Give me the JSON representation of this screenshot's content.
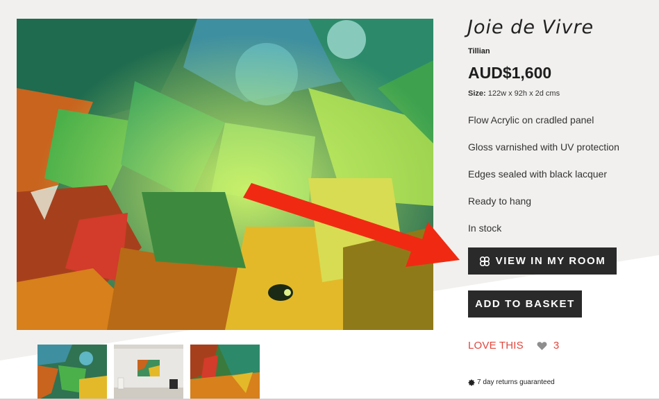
{
  "product": {
    "title": "Joie de Vivre",
    "artist": "Tillian",
    "price": "AUD$1,600",
    "size_label": "Size:",
    "size_value": "122w x 92h x 2d cms",
    "features": [
      "Flow Acrylic on cradled panel",
      "Gloss varnished with UV protection",
      "Edges sealed with black lacquer",
      "Ready to hang",
      "In stock"
    ]
  },
  "actions": {
    "view_in_room_label": "VIEW IN MY ROOM",
    "view_in_room_icon": "four-circles-icon",
    "add_to_basket_label": "ADD TO BASKET",
    "love_label": "LOVE THIS",
    "love_icon": "heart-icon",
    "love_count": "3"
  },
  "returns": {
    "icon": "badge-icon",
    "text": "7 day returns guaranteed"
  },
  "colors": {
    "accent_red": "#e0463c",
    "button_dark": "#2a2a2a",
    "arrow_red": "#f02a12"
  }
}
